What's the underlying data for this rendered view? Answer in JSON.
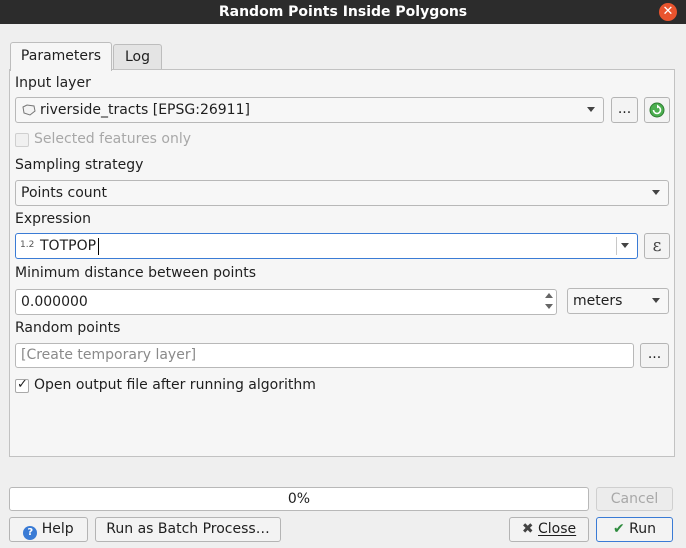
{
  "window": {
    "title": "Random Points Inside Polygons"
  },
  "tabs": [
    {
      "label": "Parameters",
      "active": true
    },
    {
      "label": "Log",
      "active": false
    }
  ],
  "params": {
    "input_layer": {
      "label": "Input layer",
      "value": "riverside_tracts [EPSG:26911]",
      "browse_label": "..."
    },
    "selected_only": {
      "label": "Selected features only",
      "checked": false,
      "enabled": false
    },
    "sampling_strategy": {
      "label": "Sampling strategy",
      "value": "Points count"
    },
    "expression": {
      "label": "Expression",
      "type_prefix": "1.2",
      "value": "TOTPOP",
      "epsilon_label": "ε"
    },
    "min_distance": {
      "label": "Minimum distance between points",
      "value": "0.000000",
      "unit": "meters"
    },
    "random_points": {
      "label": "Random points",
      "placeholder": "[Create temporary layer]",
      "browse_label": "..."
    },
    "open_output": {
      "label": "Open output file after running algorithm",
      "checked": true
    }
  },
  "progress": {
    "text": "0%",
    "percent": 0
  },
  "buttons": {
    "cancel": "Cancel",
    "help": "Help",
    "batch": "Run as Batch Process…",
    "close": "Close",
    "run": "Run"
  },
  "colors": {
    "titlebar": "#2c2c2c",
    "close_button": "#e9542e",
    "focus_border": "#3a7bd5",
    "refresh_icon": "#2e8b3e"
  }
}
